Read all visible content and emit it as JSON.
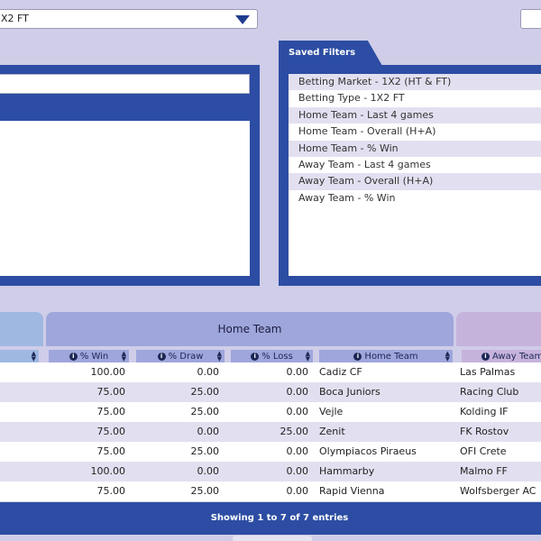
{
  "filters": {
    "betting_type_select": {
      "value": "X2 FT"
    }
  },
  "saved_filters": {
    "title": "Saved Filters",
    "items": [
      "Betting Market - 1X2 (HT & FT)",
      "Betting Type - 1X2 FT",
      "Home Team - Last 4 games",
      "Home Team - Overall (H+A)",
      "Home Team - % Win",
      "Away Team - Last 4 games",
      "Away Team - Overall (H+A)",
      "Away Team - % Win"
    ]
  },
  "table": {
    "group_home": "Home Team",
    "columns": {
      "win": "% Win",
      "draw": "% Draw",
      "loss": "% Loss",
      "home_team": "Home Team",
      "away_team": "Away Team"
    },
    "rows": [
      {
        "win": "100.00",
        "draw": "0.00",
        "loss": "0.00",
        "home": "Cadiz CF",
        "away": "Las Palmas"
      },
      {
        "win": "75.00",
        "draw": "25.00",
        "loss": "0.00",
        "home": "Boca Juniors",
        "away": "Racing Club"
      },
      {
        "win": "75.00",
        "draw": "25.00",
        "loss": "0.00",
        "home": "Vejle",
        "away": "Kolding IF"
      },
      {
        "win": "75.00",
        "draw": "0.00",
        "loss": "25.00",
        "home": "Zenit",
        "away": "FK Rostov"
      },
      {
        "win": "75.00",
        "draw": "25.00",
        "loss": "0.00",
        "home": "Olympiacos Piraeus",
        "away": "OFI Crete"
      },
      {
        "win": "100.00",
        "draw": "0.00",
        "loss": "0.00",
        "home": "Hammarby",
        "away": "Malmo FF"
      },
      {
        "win": "75.00",
        "draw": "25.00",
        "loss": "0.00",
        "home": "Rapid Vienna",
        "away": "Wolfsberger AC"
      }
    ],
    "footer": "Showing 1 to 7 of 7 entries"
  },
  "icons": {
    "info": "info-icon",
    "sort": "sort-icon",
    "dropdown": "dropdown-arrow-icon"
  },
  "colors": {
    "page_bg": "#cfcde8",
    "panel_blue": "#2c4da3",
    "home_group": "#9ea6dc",
    "away_group": "#c6b3dc",
    "row_alt": "#e2e0f0"
  }
}
